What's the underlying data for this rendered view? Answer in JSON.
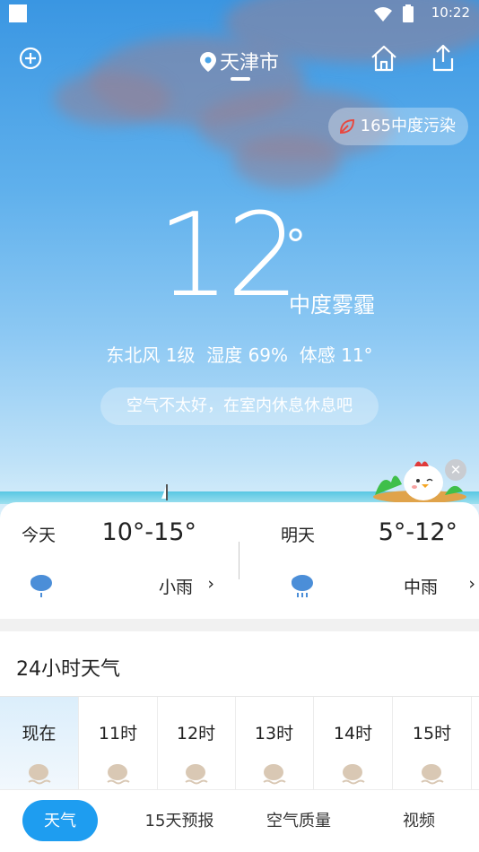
{
  "status_bar": {
    "time": "10:22",
    "icons": [
      "wifi-icon",
      "battery-icon"
    ]
  },
  "header": {
    "city": "天津市",
    "add_icon": "plus-circle-icon",
    "home_icon": "home-icon",
    "share_icon": "share-icon"
  },
  "aqi": {
    "label": "165中度污染",
    "icon": "leaf-icon"
  },
  "current": {
    "temperature": "12",
    "degree_symbol": "°",
    "condition": "中度雾霾",
    "details": "东北风 1级  湿度 69%  体感 11°",
    "tip": "空气不太好，在室内休息休息吧"
  },
  "forecast": {
    "today": {
      "label": "今天",
      "range": "10°-15°",
      "desc": "小雨",
      "icon": "light-rain-icon"
    },
    "tomorrow": {
      "label": "明天",
      "range": "5°-12°",
      "desc": "中雨",
      "icon": "moderate-rain-icon"
    }
  },
  "hourly": {
    "title": "24小时天气",
    "hours": [
      {
        "label": "现在",
        "icon": "haze-icon"
      },
      {
        "label": "11时",
        "icon": "haze-icon"
      },
      {
        "label": "12时",
        "icon": "haze-icon"
      },
      {
        "label": "13时",
        "icon": "haze-icon"
      },
      {
        "label": "14时",
        "icon": "haze-icon"
      },
      {
        "label": "15时",
        "icon": "haze-icon"
      }
    ]
  },
  "tabs": [
    {
      "label": "天气",
      "active": true
    },
    {
      "label": "15天预报",
      "active": false
    },
    {
      "label": "空气质量",
      "active": false
    },
    {
      "label": "视频",
      "active": false
    }
  ],
  "colors": {
    "accent": "#1e9df0",
    "aqi_icon": "#e8483f",
    "sky_top": "#3a96e2"
  }
}
